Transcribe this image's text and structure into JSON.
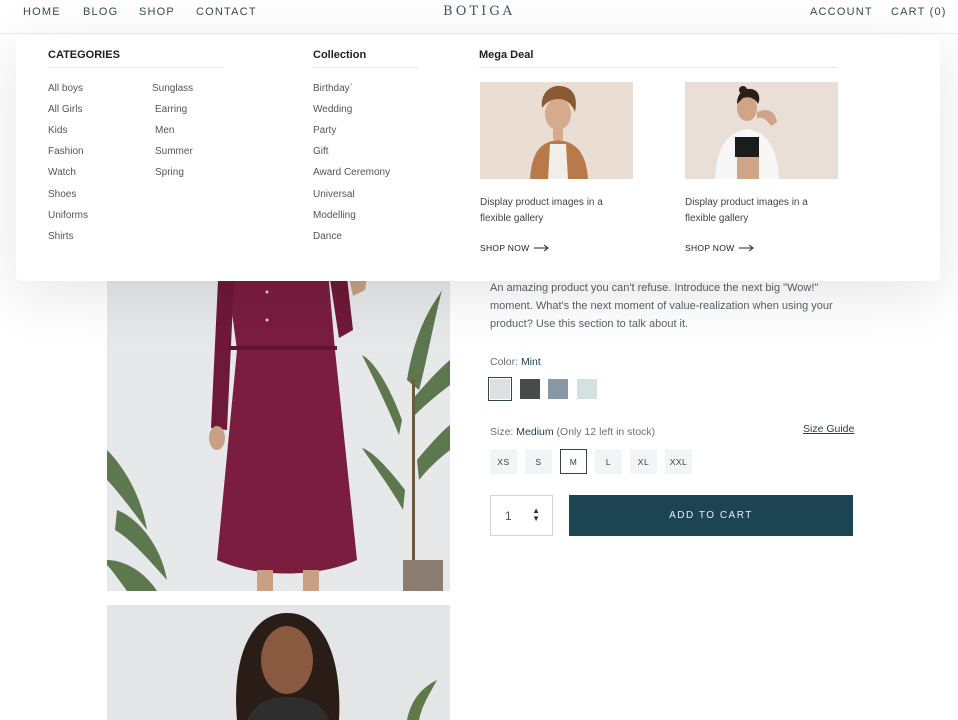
{
  "header": {
    "brand": "BOTIGA",
    "nav": [
      "HOME",
      "BLOG",
      "SHOP",
      "CONTACT"
    ],
    "account": "ACCOUNT",
    "cart": "CART (0)"
  },
  "mega_menu": {
    "categories": {
      "heading": "CATEGORIES",
      "col1": [
        "All boys",
        "All Girls",
        "Kids",
        "Fashion",
        "Watch",
        "Shoes",
        "Uniforms",
        "Shirts"
      ],
      "col2": [
        "Sunglass",
        "Earring",
        "Men",
        "Summer",
        "Spring"
      ]
    },
    "collection": {
      "heading": "Collection",
      "items": [
        "Birthday`",
        "Wedding",
        "Party",
        "Gift",
        "Award Ceremony",
        "Universal",
        "Modelling",
        "Dance"
      ]
    },
    "deal": {
      "heading": "Mega Deal",
      "cards": [
        {
          "text": "Display product images in a flexible gallery",
          "cta": "SHOP NOW"
        },
        {
          "text": "Display product images in a flexible gallery",
          "cta": "SHOP NOW"
        }
      ]
    }
  },
  "product": {
    "description": "An amazing product you can't refuse. Introduce the next big \"Wow!\" moment. What's the next moment of value-realization when using your product? Use this section to talk about it.",
    "color": {
      "label": "Color:",
      "value": "Mint",
      "swatches": [
        "#dedfe1",
        "#494a4c",
        "#8797a6",
        "#d3e2df"
      ]
    },
    "size": {
      "label": "Size:",
      "value": "Medium",
      "stock": "(Only 12 left in stock)",
      "guide": "Size Guide",
      "options": [
        "XS",
        "S",
        "M",
        "L",
        "XL",
        "XXL"
      ],
      "selected": "M"
    },
    "quantity": "1",
    "add_to_cart": "ADD TO CART"
  }
}
